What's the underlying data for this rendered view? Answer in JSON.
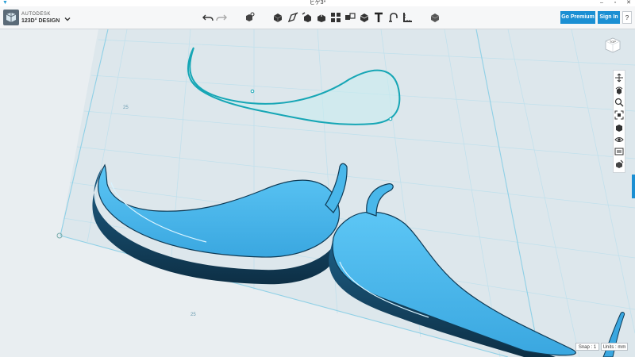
{
  "window": {
    "title": "ヒゲ3*",
    "minimize": "–",
    "maximize": "▫",
    "close": "✕"
  },
  "brand": {
    "line1": "AUTODESK",
    "line2": "123D° DESIGN"
  },
  "toolbar": {
    "icons": [
      "undo-icon",
      "redo-icon",
      "transform-icon",
      "primitives-icon",
      "sketch-icon",
      "construct-icon",
      "modify-icon",
      "pattern-icon",
      "group-icon",
      "combine-icon",
      "text-icon",
      "snap-icon",
      "measure-icon",
      "material-icon"
    ],
    "premium_label": "Go Premium",
    "signin_label": "Sign In",
    "help_label": "?"
  },
  "viewcube": {
    "label": "TOP"
  },
  "navbar": {
    "icons": [
      "pan-icon",
      "orbit-icon",
      "zoom-icon",
      "fit-icon",
      "views-icon",
      "visibility-icon",
      "hide-icon",
      "material-icon"
    ]
  },
  "grid": {
    "labels": [
      "25",
      "25"
    ]
  },
  "status": {
    "snap": "Snap : 1",
    "units": "Units : mm"
  },
  "colors": {
    "accent": "#1b8fd3",
    "model": "#58c3f2",
    "sketch": "#1aa7b5",
    "grid": "#b7e3f0"
  }
}
